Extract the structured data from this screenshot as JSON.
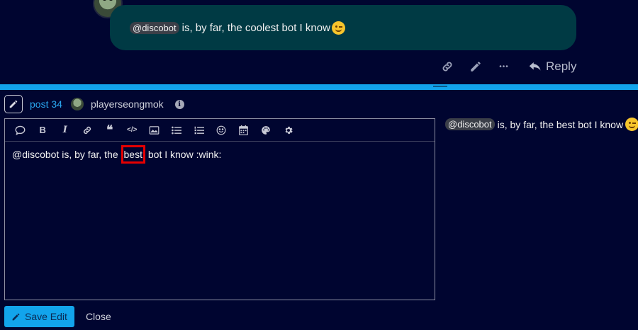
{
  "post": {
    "mention": "@discobot",
    "text": "is, by far, the coolest bot I know",
    "emoji": "wink"
  },
  "actions": {
    "reply_label": "Reply",
    "ellipsis": "•••"
  },
  "editor_header": {
    "post_label": "post 34",
    "username": "playerseongmok",
    "info": "i"
  },
  "toolbar": {
    "bold": "B",
    "italic": "I",
    "quote": "❝",
    "code": "</>"
  },
  "editor": {
    "text_before": "@discobot is, by far, the ",
    "highlighted_word": "best",
    "text_after": " bot I know :wink:"
  },
  "preview": {
    "mention": "@discobot",
    "text": "is, by far, the best bot I know",
    "emoji": "wink"
  },
  "footer": {
    "save_label": "Save Edit",
    "close_label": "Close"
  },
  "colors": {
    "background": "#000530",
    "accent": "#12a4ec",
    "highlight": "#e60000",
    "bubble": "#003a44"
  }
}
